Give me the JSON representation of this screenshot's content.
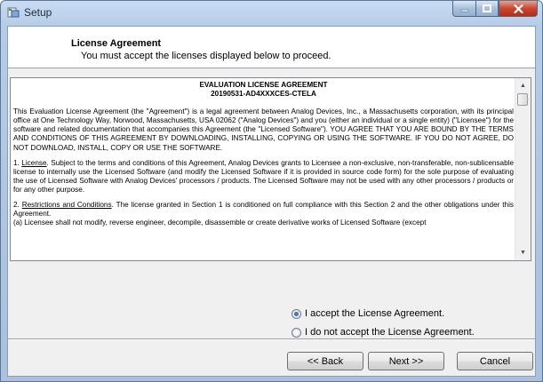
{
  "window": {
    "title": "Setup",
    "icon": "setup-installer-icon",
    "controls": [
      "minimize-icon",
      "maximize-icon",
      "close-icon"
    ]
  },
  "header": {
    "title": "License Agreement",
    "subtitle": "You must accept the licenses displayed below to proceed."
  },
  "license": {
    "heading": "EVALUATION LICENSE AGREEMENT",
    "id": "20190531-AD4XXXCES-CTELA",
    "para1": "This Evaluation License Agreement (the \"Agreement\") is a legal agreement between Analog Devices, Inc., a Massachusetts corporation, with its principal office at One Technology Way, Norwood, Massachusetts, USA 02062 (\"Analog Devices\") and you (either an individual or a single entity) (\"Licensee\") for the software and related documentation that accompanies this Agreement (the \"Licensed Software\").   YOU AGREE THAT YOU ARE BOUND BY THE TERMS AND CONDITIONS OF THIS AGREEMENT BY DOWNLOADING, INSTALLING, COPYING OR USING THE SOFTWARE. IF YOU DO NOT AGREE, DO NOT DOWNLOAD, INSTALL, COPY OR USE THE SOFTWARE.",
    "para2_num": "1.",
    "para2_title": "License",
    "para2_body": ".  Subject to the terms and conditions of this Agreement, Analog Devices grants to Licensee a non-exclusive, non-transferable, non-sublicensable license to internally use the Licensed Software (and modify the Licensed Software if it is provided in source code form) for the sole purpose of evaluating the use of Licensed Software with Analog Devices' processors / products. The Licensed Software may not be used with any other processors / products or for any other purpose.",
    "para3_num": "2.",
    "para3_title": "Restrictions and Conditions",
    "para3_body": ".  The license granted in Section 1 is conditioned on full compliance with this Section 2 and the other obligations under this Agreement.",
    "para3_item_a": "(a) Licensee shall not modify, reverse engineer, decompile, disassemble or create derivative works of Licensed Software (except"
  },
  "options": {
    "accept_label": "I accept the License Agreement.",
    "decline_label": "I do not accept the License Agreement.",
    "selected": "accept"
  },
  "buttons": {
    "back": "<< Back",
    "next": "Next >>",
    "cancel": "Cancel"
  }
}
